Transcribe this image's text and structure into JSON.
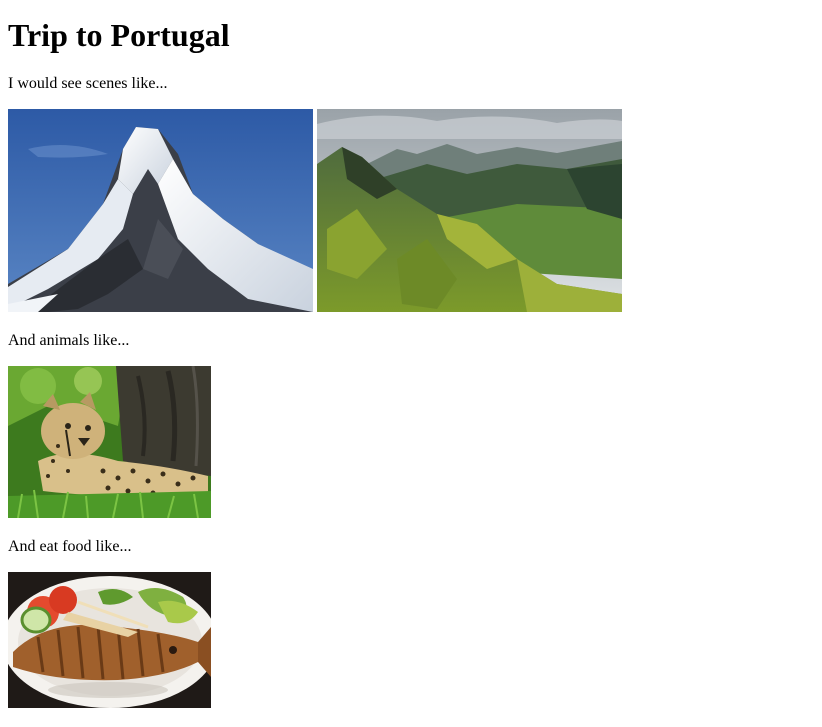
{
  "page": {
    "title": "Trip to Portugal",
    "scenes_intro": "I would see scenes like...",
    "animals_intro": "And animals like...",
    "food_intro": "And eat food like..."
  },
  "images": {
    "scenes": [
      {
        "subject": "snow-capped mountain peak under blue sky"
      },
      {
        "subject": "green mountain valley with cloudy sky"
      }
    ],
    "animals": [
      {
        "subject": "cheetah lying in grass beside a tree trunk"
      }
    ],
    "food": [
      {
        "subject": "grilled fish on a plate with salad"
      }
    ]
  }
}
